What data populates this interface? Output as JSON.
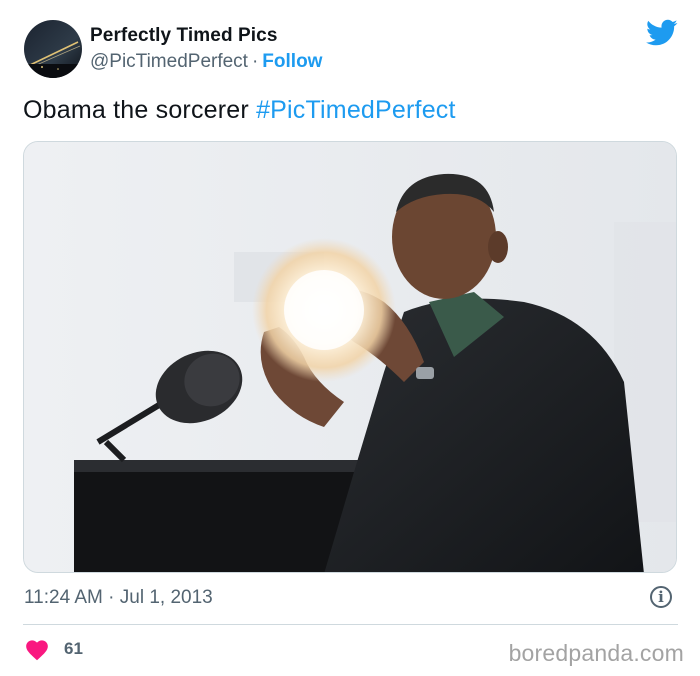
{
  "tweet": {
    "display_name": "Perfectly Timed Pics",
    "handle": "@PicTimedPerfect",
    "separator": "·",
    "follow_label": "Follow",
    "text": "Obama the sorcerer",
    "hashtag": "#PicTimedPerfect",
    "time": "11:24 AM",
    "date_separator": "·",
    "date": "Jul 1, 2013",
    "info_symbol": "i",
    "like_count": "61"
  },
  "watermark": "boredpanda.com",
  "icons": {
    "brand": "twitter-bird-icon",
    "info": "info-icon",
    "like": "heart-icon"
  },
  "colors": {
    "accent": "#1d9bf0",
    "heart": "#f91880",
    "secondary_text": "#536471",
    "border": "#cfd9de"
  }
}
